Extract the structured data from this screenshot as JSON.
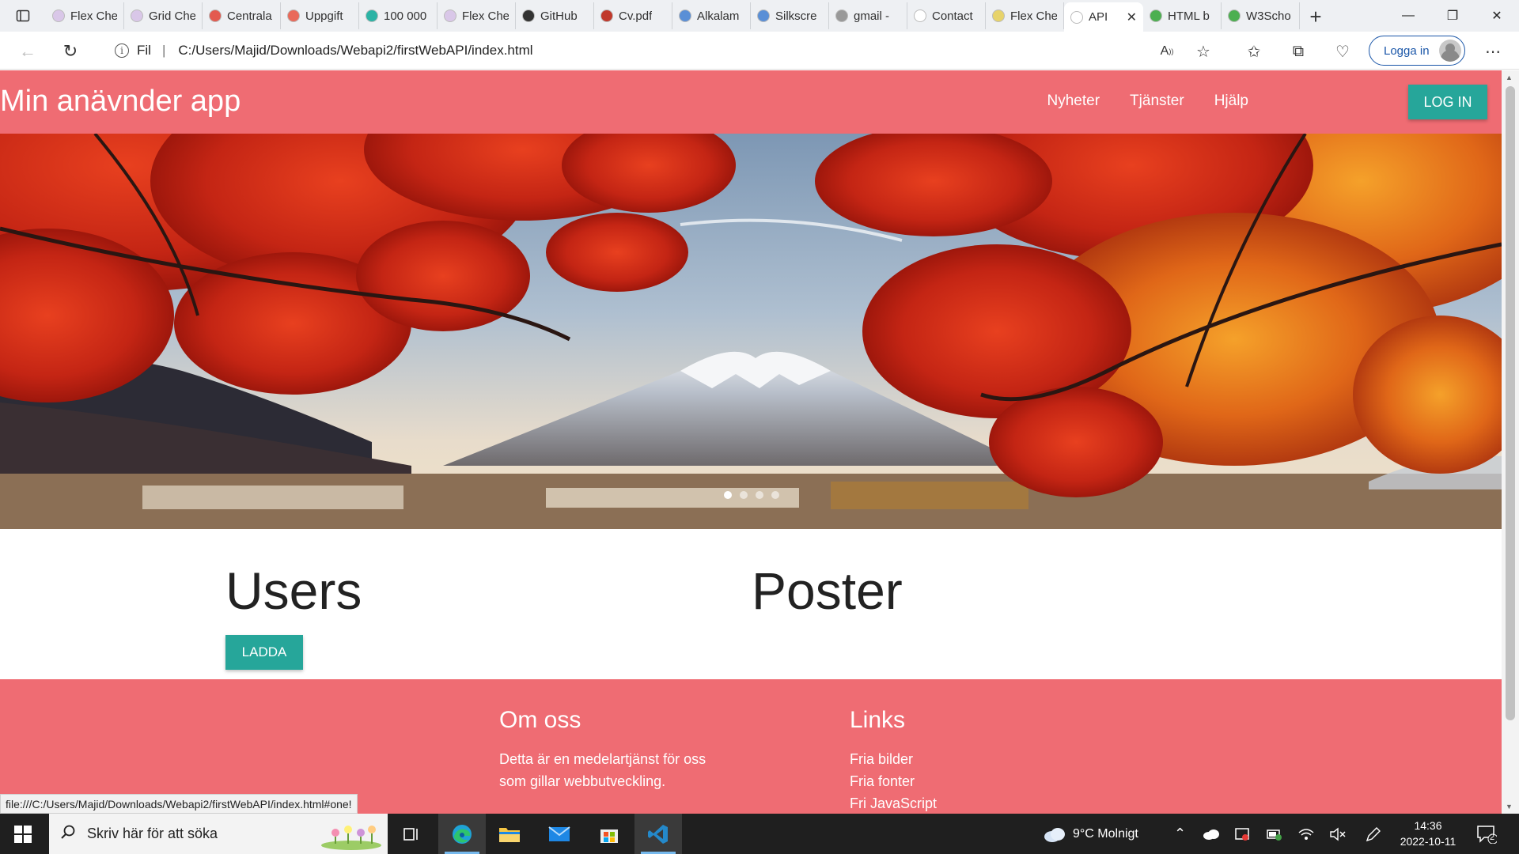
{
  "browser": {
    "tabs": [
      {
        "title": "Flex Che",
        "fav": "#d9c7e8"
      },
      {
        "title": "Grid Che",
        "fav": "#d9c7e8"
      },
      {
        "title": "Centrala",
        "fav": "#e35a4f"
      },
      {
        "title": "Uppgift",
        "fav": "#e96a5a"
      },
      {
        "title": "100 000",
        "fav": "#2bb3a5"
      },
      {
        "title": "Flex Che",
        "fav": "#d9c7e8"
      },
      {
        "title": "GitHub",
        "fav": "#333333"
      },
      {
        "title": "Cv.pdf",
        "fav": "#c0392b"
      },
      {
        "title": "Alkalam",
        "fav": "#5a8fd6"
      },
      {
        "title": "Silkscre",
        "fav": "#5a8fd6"
      },
      {
        "title": "gmail -",
        "fav": "#999999"
      },
      {
        "title": "Contact",
        "fav": "#ffffff"
      },
      {
        "title": "Flex Che",
        "fav": "#e7d36b"
      },
      {
        "title": "API",
        "fav": "#ffffff"
      },
      {
        "title": "HTML b",
        "fav": "#4caf50"
      },
      {
        "title": "W3Scho",
        "fav": "#4caf50"
      }
    ],
    "active_tab_index": 13,
    "address_prefix": "Fil",
    "address_url": "C:/Users/Majid/Downloads/Webapi2/firstWebAPI/index.html",
    "login_label": "Logga in",
    "status_url": "file:///C:/Users/Majid/Downloads/Webapi2/firstWebAPI/index.html#one!"
  },
  "site": {
    "brand": "Min anävnder app",
    "menu": [
      "Nyheter",
      "Tjänster",
      "Hjälp"
    ],
    "login_button": "LOG IN",
    "carousel": {
      "slides": 4,
      "active": 0
    },
    "users_heading": "Users",
    "poster_heading": "Poster",
    "load_button": "LADDA",
    "footer": {
      "about_heading": "Om oss",
      "about_text": "Detta är en medelartjänst för oss som gillar webbutveckling.",
      "links_heading": "Links",
      "links": [
        "Fria bilder",
        "Fria fonter",
        "Fri JavaScript"
      ]
    },
    "colors": {
      "primary": "#ef6c73",
      "accent": "#26a69a"
    }
  },
  "taskbar": {
    "search_placeholder": "Skriv här för att söka",
    "weather": "9°C  Molnigt",
    "time": "14:36",
    "date": "2022-10-11",
    "notifications": "2"
  }
}
